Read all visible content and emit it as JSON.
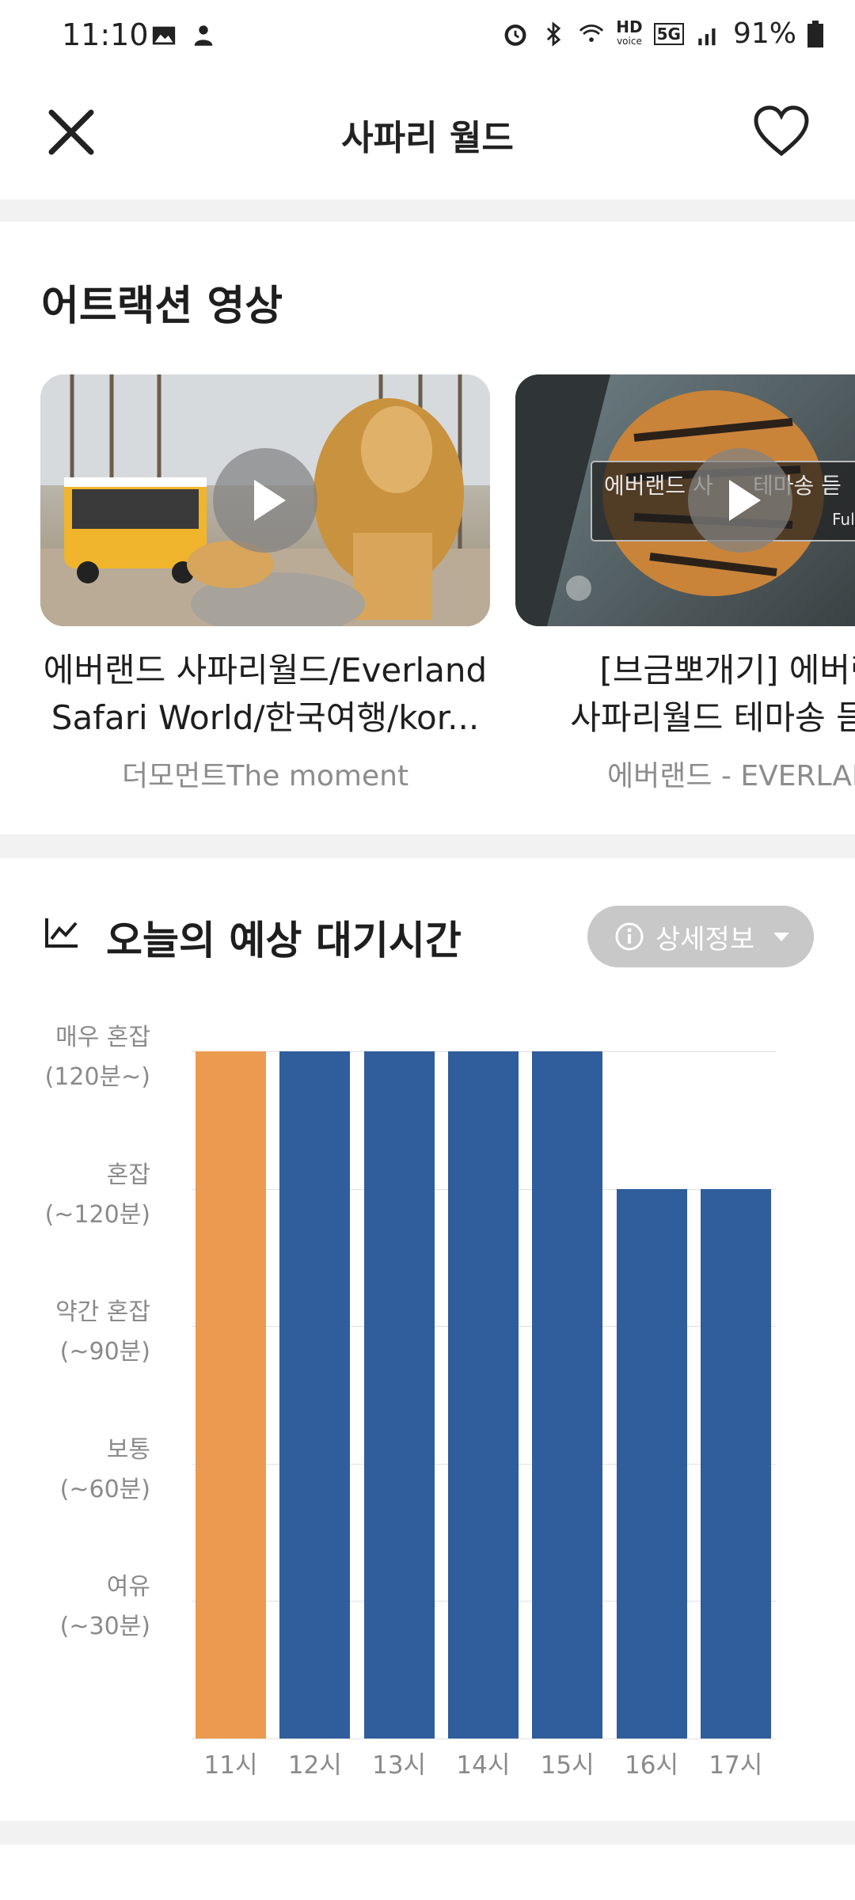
{
  "status_bar": {
    "time": "11:10",
    "battery": "91%",
    "hd_label": "HD",
    "voice_label": "voice",
    "network_label": "5G",
    "icons": [
      "image-icon",
      "person-icon",
      "alarm-icon",
      "bluetooth-icon",
      "wifi-icon",
      "signal-icon",
      "battery-icon"
    ]
  },
  "header": {
    "title": "사파리 월드",
    "close_icon": "close-icon",
    "favorite_icon": "heart-icon"
  },
  "videos_section": {
    "title": "어트랙션 영상",
    "videos": [
      {
        "title_line1": "에버랜드 사파리월드/Everland",
        "title_line2": "Safari World/한국여행/kor...",
        "channel": "더모먼트The moment",
        "thumb_label": ""
      },
      {
        "title_line1": "[브금뽀개기] 에버랜",
        "title_line2": "사파리월드 테마송 듣기(",
        "channel": "에버랜드 - EVERLAN",
        "thumb_label": "에버랜드 사",
        "thumb_label2": "테마송 듣",
        "thumb_label3": "Full"
      }
    ]
  },
  "wait_section": {
    "title": "오늘의 예상 대기시간",
    "detail_button": "상세정보",
    "colors": {
      "current": "#EC9A50",
      "forecast": "#305D9B"
    }
  },
  "chart_data": {
    "type": "bar",
    "categories": [
      "11시",
      "12시",
      "13시",
      "14시",
      "15시",
      "16시",
      "17시"
    ],
    "values": [
      5,
      5,
      5,
      5,
      5,
      4,
      4
    ],
    "highlight_index": 0,
    "ylim": [
      0,
      5
    ],
    "y_levels": [
      {
        "value": 5,
        "line1": "매우 혼잡",
        "line2": "(120분~)"
      },
      {
        "value": 4,
        "line1": "혼잡",
        "line2": "(~120분)"
      },
      {
        "value": 3,
        "line1": "약간 혼잡",
        "line2": "(~90분)"
      },
      {
        "value": 2,
        "line1": "보통",
        "line2": "(~60분)"
      },
      {
        "value": 1,
        "line1": "여유",
        "line2": "(~30분)"
      }
    ],
    "grid": true
  }
}
